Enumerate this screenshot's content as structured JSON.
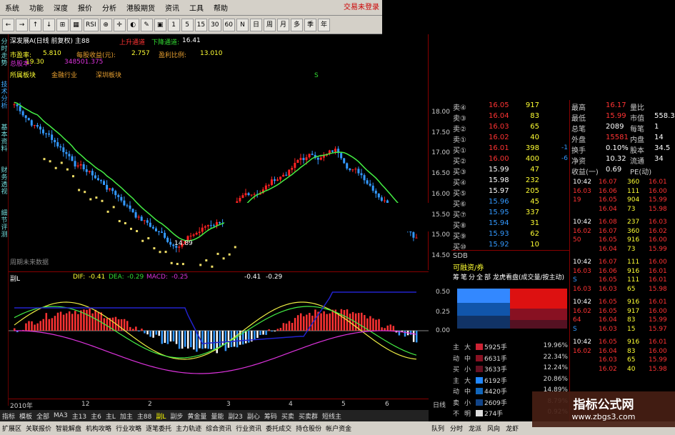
{
  "title_bar": {
    "text": "...大智慧/证券分析/新功能..."
  },
  "menu": [
    "系统",
    "功能",
    "报价",
    "分析",
    "港股期货",
    "资讯",
    "工具",
    "帮助"
  ],
  "menu_extra": "深度",
  "login_status": "交易未登录",
  "toolbar": [
    "←",
    "→",
    "↑",
    "↓",
    "⊞",
    "▦",
    "RSI",
    "⊕",
    "✛",
    "◐",
    "✎",
    "▣",
    "1",
    "5",
    "15",
    "30",
    "60",
    "N",
    "日",
    "周",
    "月",
    "多",
    "季",
    "年"
  ],
  "side_tabs": [
    "分时走势",
    "技术分析",
    "基本资料",
    "财务透视",
    "細节评测"
  ],
  "main_chart": {
    "header": "深发展A(日线 前复权) 主88",
    "upper_channel": "上升通道",
    "lower_channel_label": "下降通道:",
    "lower_channel_value": "16.41",
    "pe_label": "市盈率:",
    "pe_value": "5.810",
    "eps_label": "每股收益(元):",
    "eps_value": "2.757",
    "profit_ratio_label": "盈利比例:",
    "profit_ratio_value": "13.010",
    "total_label": "总股本:",
    "total_value": "348501.375",
    "share_price_hint": "19.30",
    "sector_label": "所属板块",
    "industry_label": "金融行业",
    "region_label": "深圳板块",
    "low_marker": "14.89",
    "high_marker": "S",
    "footer_text": "周期未来数据",
    "price_ticks": [
      "18.00",
      "17.50",
      "17.00",
      "16.50",
      "16.00",
      "15.50",
      "15.00",
      "14.50"
    ]
  },
  "sub_chart": {
    "name": "副L",
    "dif_label": "DIF:",
    "dif_value": "-0.41",
    "dea_label": "DEA:",
    "dea_value": "-0.29",
    "macd_label": "MACD:",
    "macd_value": "-0.25",
    "extra_value": "-0.41",
    "extra_value2": "-0.29",
    "axis": [
      "0.50",
      "0.25",
      "0.00"
    ]
  },
  "time_axis": [
    "2010年",
    "12",
    "2",
    "3",
    "4",
    "5",
    "6"
  ],
  "time_axis_right": "日线",
  "bottom_tabs": [
    "指标",
    "模板",
    "全部",
    "MA3",
    "主13",
    "主6",
    "主L",
    "加主",
    "主88",
    "副L",
    "副步",
    "黄金量",
    "量能",
    "副23",
    "副心",
    "筹码",
    "买卖",
    "买卖群",
    "短线主"
  ],
  "nav_links": [
    "扩展区",
    "关联报价",
    "智能解盘",
    "机构攻略",
    "行业攻略",
    "逐笔委托",
    "主力轨迹",
    "综合资讯",
    "行业资讯",
    "委托成交",
    "持仓股份",
    "帐户资金"
  ],
  "order_book": {
    "sells": [
      {
        "label": "卖④",
        "price": "16.05",
        "vol": "917"
      },
      {
        "label": "卖③",
        "price": "16.04",
        "vol": "83"
      },
      {
        "label": "卖②",
        "price": "16.03",
        "vol": "65"
      },
      {
        "label": "卖①",
        "price": "16.02",
        "vol": "40"
      }
    ],
    "buys": [
      {
        "label": "买①",
        "price": "16.01",
        "vol": "398"
      },
      {
        "label": "买②",
        "price": "16.00",
        "vol": "400"
      },
      {
        "label": "买③",
        "price": "15.99",
        "vol": "47"
      },
      {
        "label": "买④",
        "price": "15.98",
        "vol": "232"
      },
      {
        "label": "买⑤",
        "price": "15.97",
        "vol": "205"
      },
      {
        "label": "买⑥",
        "price": "15.96",
        "vol": "45"
      },
      {
        "label": "买⑦",
        "price": "15.95",
        "vol": "337"
      },
      {
        "label": "买⑧",
        "price": "15.94",
        "vol": "31"
      },
      {
        "label": "买⑨",
        "price": "15.93",
        "vol": "62"
      },
      {
        "label": "买⑩",
        "price": "15.92",
        "vol": "10"
      }
    ],
    "changes": [
      "-1",
      "-6"
    ]
  },
  "sdb": {
    "label": "SDB",
    "sub": "可融资/券"
  },
  "fund_flow": {
    "tabs": [
      "筹",
      "笔",
      "分",
      "全",
      "部"
    ],
    "title": "龙虎看盘(成交量/按主动)",
    "axis": [
      "0.50",
      "0.25"
    ]
  },
  "flow_rows": [
    {
      "a": "主",
      "b": "大",
      "v": "5925手",
      "p": "19.96%",
      "c": "#cc2233"
    },
    {
      "a": "动",
      "b": "中",
      "v": "6631手",
      "p": "22.34%",
      "c": "#881122"
    },
    {
      "a": "买",
      "b": "小",
      "v": "3633手",
      "p": "12.24%",
      "c": "#661122"
    },
    {
      "a": "主",
      "b": "大",
      "v": "6192手",
      "p": "20.86%",
      "c": "#2288ff"
    },
    {
      "a": "动",
      "b": "中",
      "v": "4420手",
      "p": "14.89%",
      "c": "#1166bb"
    },
    {
      "a": "卖",
      "b": "小",
      "v": "2609手",
      "p": "8.79%",
      "c": "#114488"
    },
    {
      "a": "不",
      "b": "明",
      "v": "274手",
      "p": "0.92%",
      "c": "#dddddd"
    }
  ],
  "right_stats": [
    {
      "l": "最高",
      "v": "16.17",
      "l2": "量比",
      "v2": ""
    },
    {
      "l": "最低",
      "v": "15.99",
      "l2": "市值",
      "v2": "558.3"
    },
    {
      "l": "总笔",
      "v": "2089",
      "l2": "每笔",
      "v2": "1"
    },
    {
      "l": "外盘",
      "v": "15581",
      "l2": "内盘",
      "v2": "14"
    },
    {
      "l": "换手",
      "v": "0.10%",
      "l2": "股本",
      "v2": "34.5"
    },
    {
      "l": "净资",
      "v": "10.32",
      "l2": "流通",
      "v2": "34"
    },
    {
      "l": "收益(一)",
      "v": "0.69",
      "l2": "PE(动)",
      "v2": ""
    }
  ],
  "ticks": [
    {
      "t": "10:42",
      "a": "16.03",
      "b": "16.07",
      "c": "360",
      "d": "16.01"
    },
    {
      "t": "",
      "a": "16.03",
      "b": "16.06",
      "c": "111",
      "d": "16.00"
    },
    {
      "t": "",
      "a": "19",
      "b": "16.05",
      "c": "904",
      "d": "15.99"
    },
    {
      "t": "",
      "a": "",
      "b": "16.04",
      "c": "73",
      "d": "15.98"
    },
    {
      "t": "10:42",
      "a": "16.03",
      "b": "16.08",
      "c": "237",
      "d": "16.03"
    },
    {
      "t": "",
      "a": "16.02",
      "b": "16.07",
      "c": "360",
      "d": "16.02"
    },
    {
      "t": "",
      "a": "50",
      "b": "16.05",
      "c": "916",
      "d": "16.00"
    },
    {
      "t": "",
      "a": "",
      "b": "16.04",
      "c": "73",
      "d": "15.99"
    },
    {
      "t": "10:42",
      "a": "16.03",
      "b": "16.07",
      "c": "111",
      "d": "16.00"
    },
    {
      "t": "",
      "a": "16.03",
      "b": "16.06",
      "c": "916",
      "d": "16.01"
    },
    {
      "t": "",
      "a": "S",
      "b": "16.05",
      "c": "111",
      "d": "16.01"
    },
    {
      "t": "",
      "a": "16.03",
      "b": "16.03",
      "c": "65",
      "d": "15.98"
    },
    {
      "t": "10:42",
      "a": "16.03",
      "b": "16.05",
      "c": "916",
      "d": "16.01"
    },
    {
      "t": "",
      "a": "16.02",
      "b": "16.05",
      "c": "917",
      "d": "16.00"
    },
    {
      "t": "",
      "a": "64",
      "b": "16.04",
      "c": "83",
      "d": "15.99"
    },
    {
      "t": "",
      "a": "S",
      "b": "16.03",
      "c": "15",
      "d": "15.97"
    },
    {
      "t": "10:42",
      "a": "16.03",
      "b": "16.05",
      "c": "916",
      "d": "16.01"
    },
    {
      "t": "",
      "a": "16.02",
      "b": "16.04",
      "c": "83",
      "d": "16.00"
    },
    {
      "t": "",
      "a": "",
      "b": "16.03",
      "c": "65",
      "d": "15.99"
    },
    {
      "t": "",
      "a": "",
      "b": "16.02",
      "c": "40",
      "d": "15.98"
    }
  ],
  "right_bottom": [
    "队列",
    "分时",
    "龙派",
    "风向",
    "龙虾"
  ],
  "watermark": {
    "title": "指标公式网",
    "url": "www.zbgs3.com"
  },
  "colors": {
    "up": "#ff3333",
    "down": "#3399ff",
    "ma_green": "#44ee44",
    "ma_yellow": "#eeee44",
    "macd_blue": "#2222cc"
  }
}
